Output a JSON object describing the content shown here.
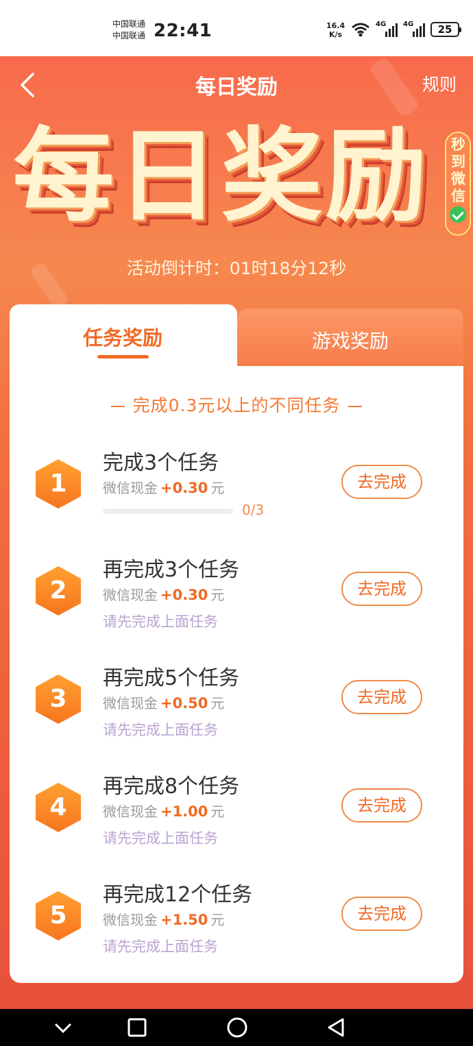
{
  "status_bar": {
    "carrier1": "中国联通",
    "carrier2": "中国联通",
    "time": "22:41",
    "net_speed_value": "16.4",
    "net_speed_unit": "K/s",
    "signal1_label": "4G",
    "signal2_label": "4G",
    "battery": "25"
  },
  "nav": {
    "title": "每日奖励",
    "rules_label": "规则"
  },
  "hero": {
    "title": "每日奖励",
    "badge_text": "秒到微信",
    "countdown": "活动倒计时：01时18分12秒"
  },
  "tabs": [
    {
      "label": "任务奖励",
      "active": true
    },
    {
      "label": "游戏奖励",
      "active": false
    }
  ],
  "section_subtitle": "完成0.3元以上的不同任务",
  "tasks": [
    {
      "index": "1",
      "title": "完成3个任务",
      "reward_prefix": "微信现金",
      "amount": "+0.30",
      "unit": "元",
      "progress_text": "0/3",
      "progress_fraction": 0,
      "note": "",
      "button": "去完成"
    },
    {
      "index": "2",
      "title": "再完成3个任务",
      "reward_prefix": "微信现金",
      "amount": "+0.30",
      "unit": "元",
      "note": "请先完成上面任务",
      "button": "去完成"
    },
    {
      "index": "3",
      "title": "再完成5个任务",
      "reward_prefix": "微信现金",
      "amount": "+0.50",
      "unit": "元",
      "note": "请先完成上面任务",
      "button": "去完成"
    },
    {
      "index": "4",
      "title": "再完成8个任务",
      "reward_prefix": "微信现金",
      "amount": "+1.00",
      "unit": "元",
      "note": "请先完成上面任务",
      "button": "去完成"
    },
    {
      "index": "5",
      "title": "再完成12个任务",
      "reward_prefix": "微信现金",
      "amount": "+1.50",
      "unit": "元",
      "note": "请先完成上面任务",
      "button": "去完成"
    }
  ],
  "colors": {
    "accent": "#f06a25",
    "hero_top": "#f86a4c",
    "hero_bottom": "#e8513b",
    "note": "#b9a3d1"
  },
  "system_nav": [
    "chevron-down-icon",
    "square-icon",
    "circle-icon",
    "triangle-back-icon"
  ]
}
